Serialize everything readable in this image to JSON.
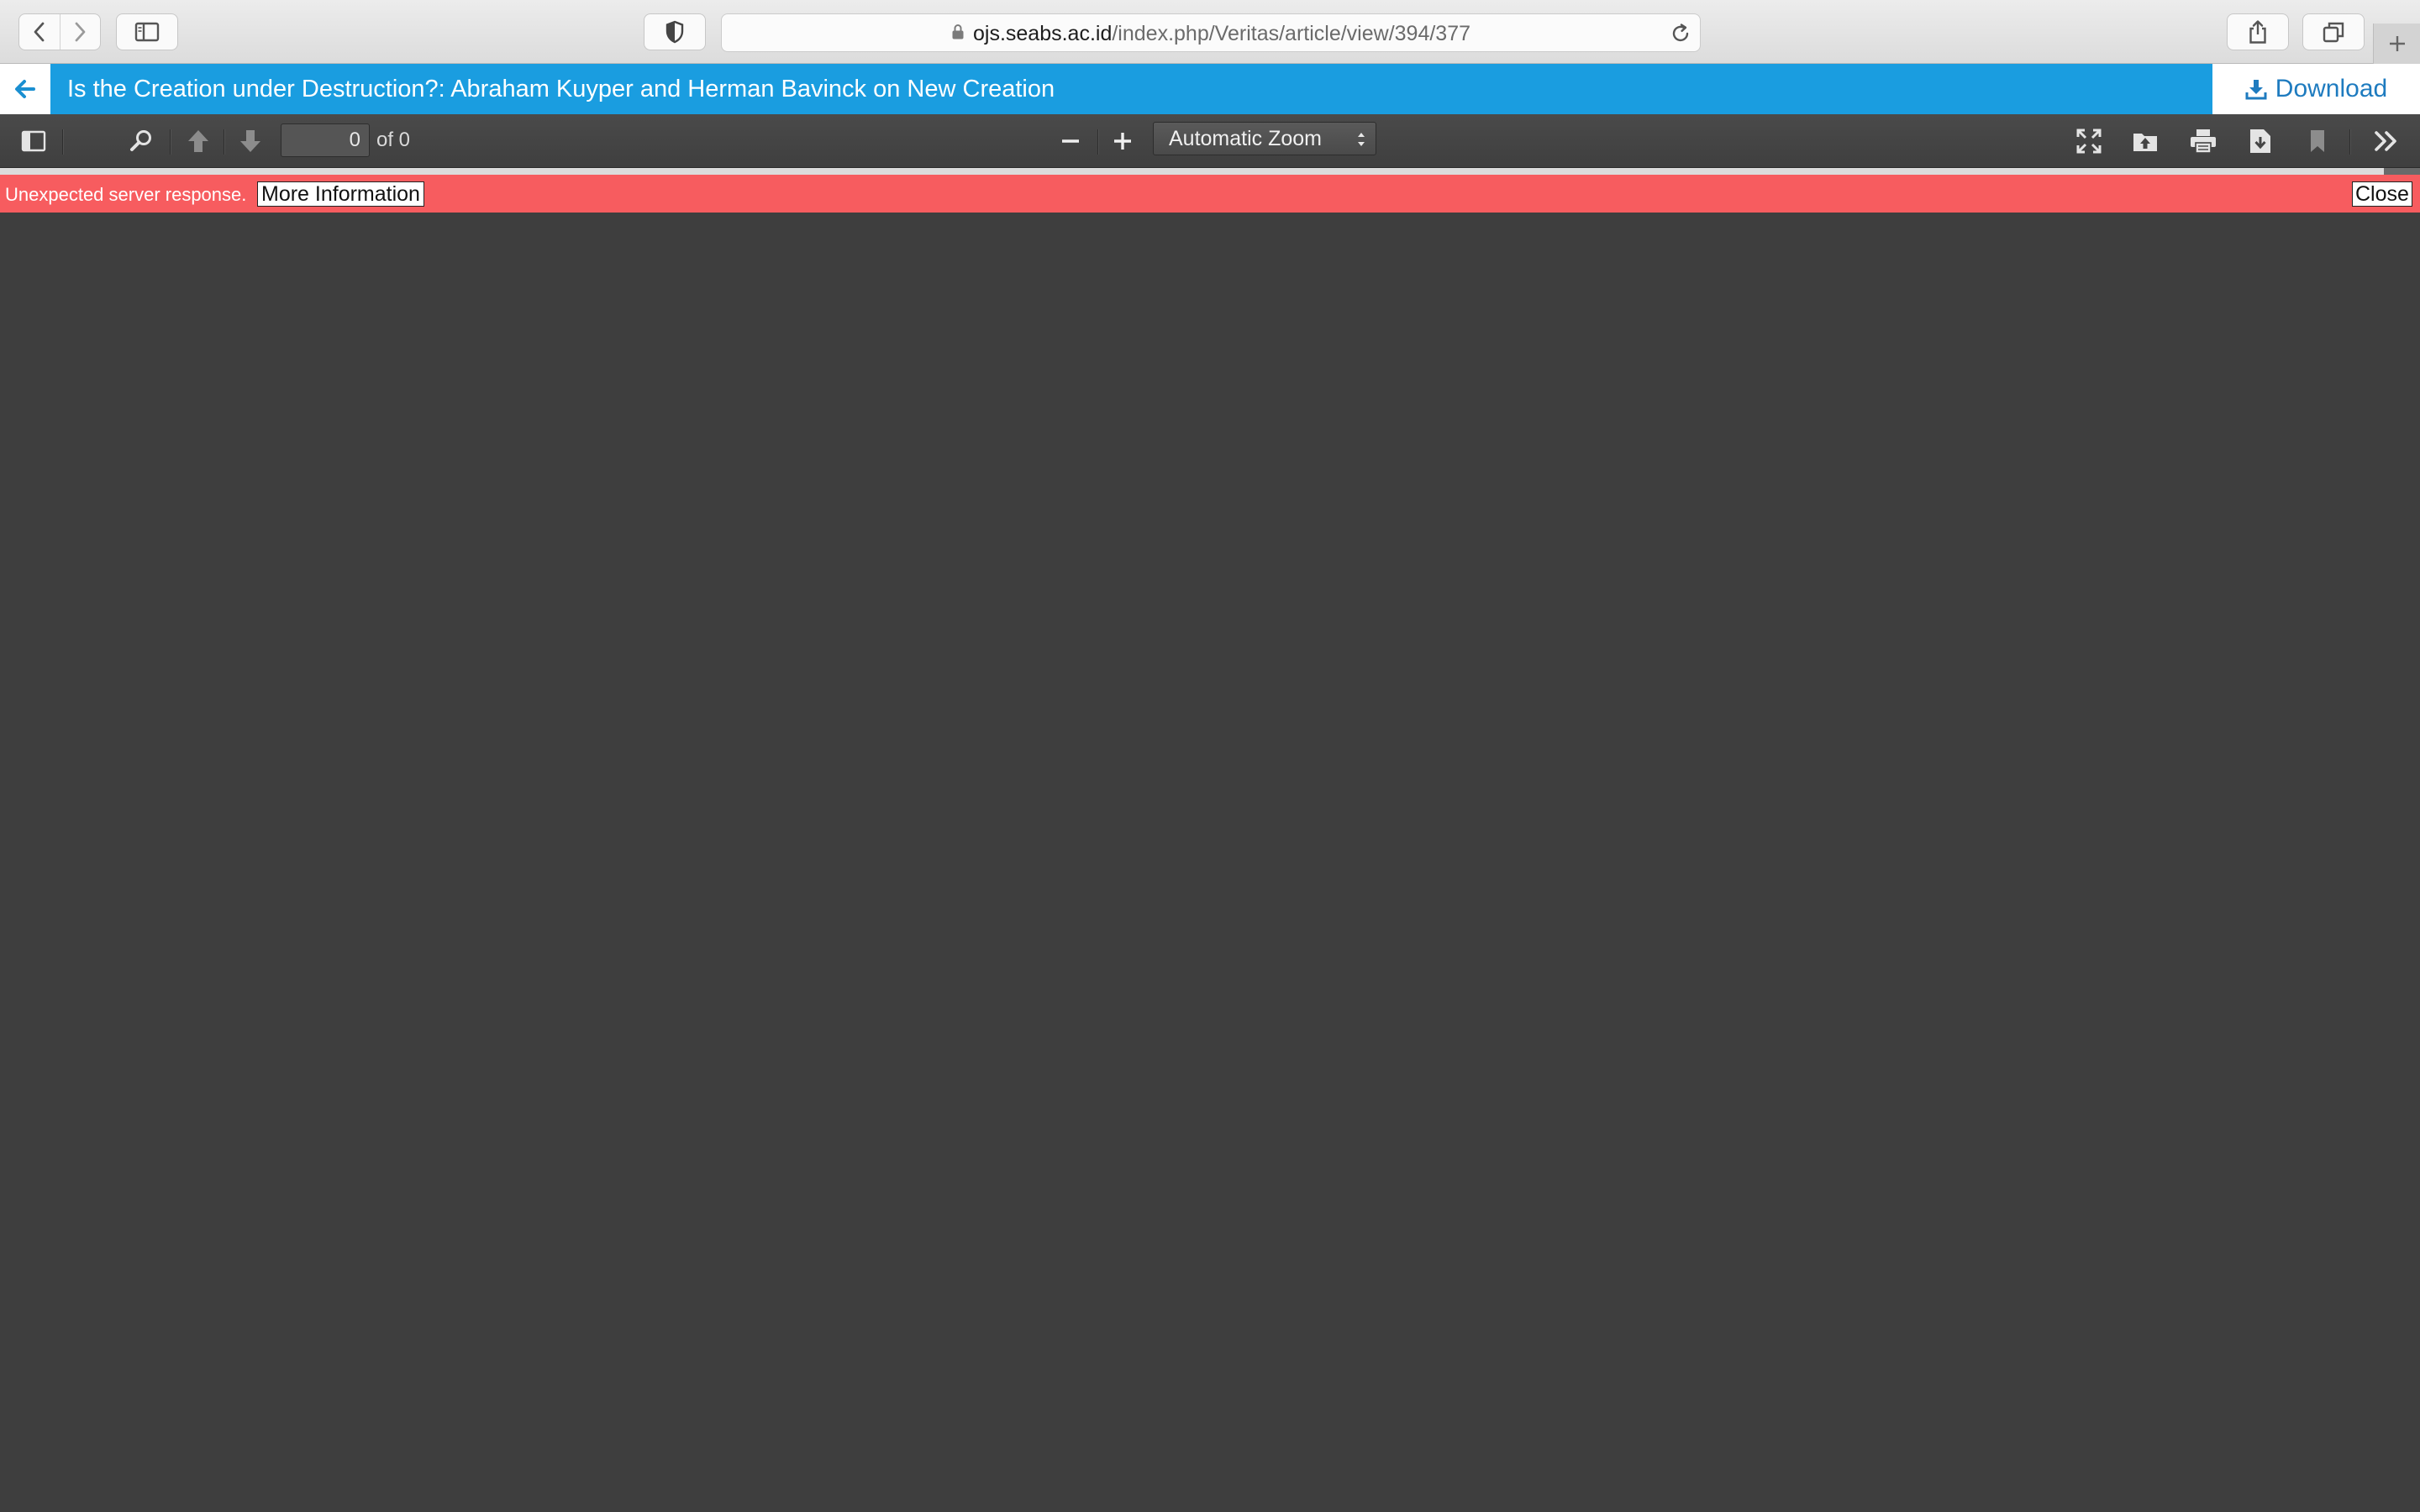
{
  "browser": {
    "url_domain": "ojs.seabs.ac.id",
    "url_path": "/index.php/Veritas/article/view/394/377"
  },
  "ojs": {
    "title": "Is the Creation under Destruction?: Abraham Kuyper and Herman Bavinck on New Creation",
    "download_label": "Download",
    "accent": "#1a9de0"
  },
  "pdf_toolbar": {
    "page_value": "0",
    "page_count_text": "of 0",
    "zoom_label": "Automatic Zoom",
    "load_progress": 0.985
  },
  "error": {
    "message": "Unexpected server response.",
    "more_info_label": "More Information",
    "close_label": "Close",
    "color": "#f75c5f"
  },
  "icons": [
    "chevron-left-icon",
    "chevron-right-icon",
    "sidebar-icon",
    "shield-icon",
    "lock-icon",
    "reload-icon",
    "share-icon",
    "tabs-icon",
    "plus-icon",
    "arrow-left-icon",
    "download-icon",
    "toggle-sidebar-icon",
    "search-icon",
    "previous-page-icon",
    "next-page-icon",
    "zoom-out-icon",
    "zoom-in-icon",
    "presentation-mode-icon",
    "open-file-icon",
    "print-icon",
    "save-icon",
    "bookmark-icon",
    "tools-icon"
  ]
}
